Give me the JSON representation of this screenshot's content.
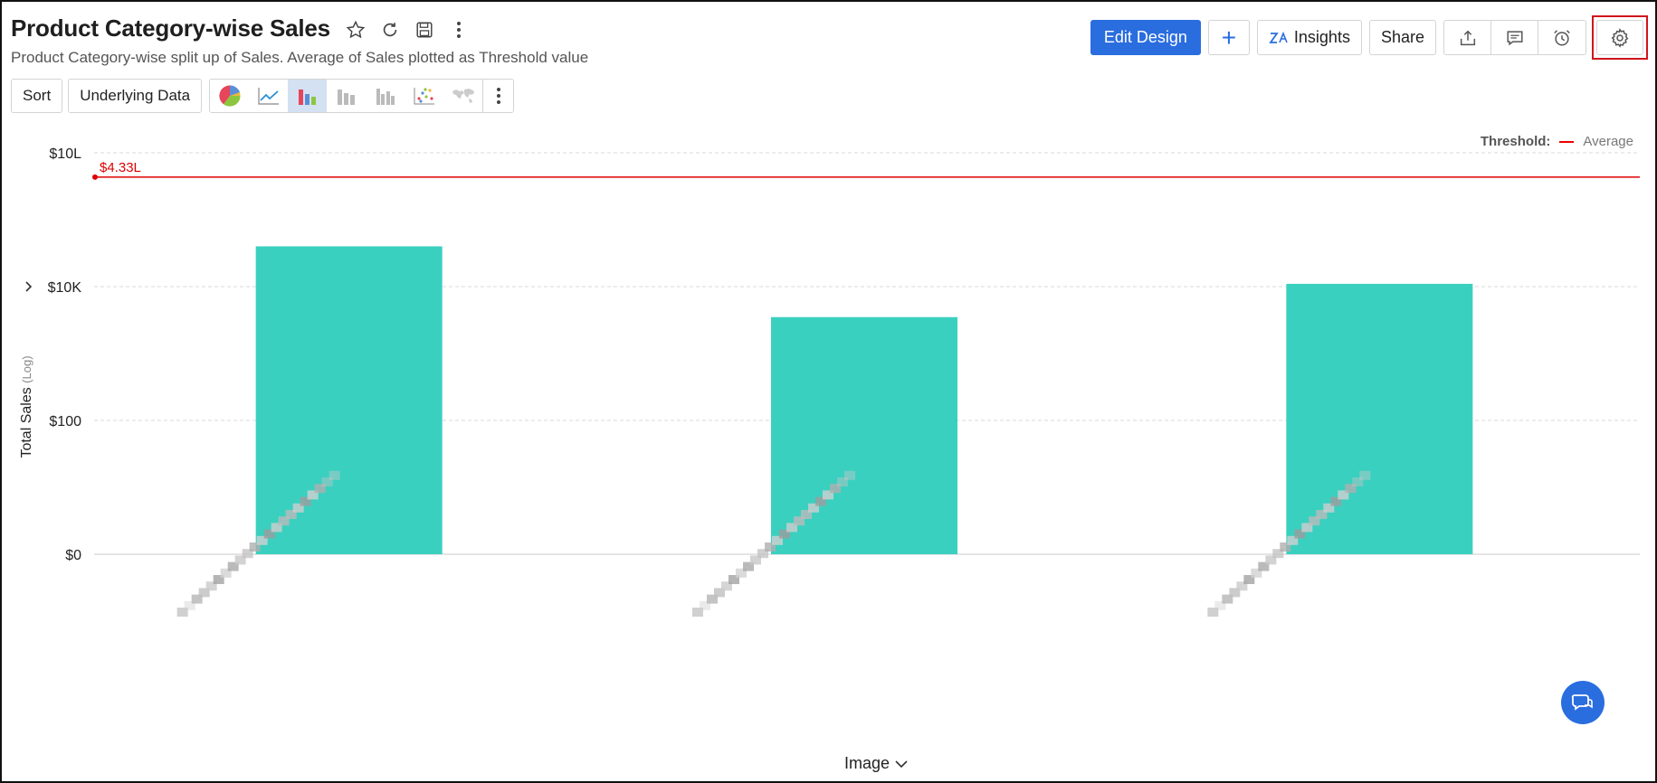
{
  "header": {
    "title": "Product Category-wise Sales",
    "subtitle": "Product Category-wise split up of Sales. Average of Sales plotted as Threshold value"
  },
  "topbar": {
    "edit_design": "Edit Design",
    "add": "+",
    "insights": "Insights",
    "share": "Share"
  },
  "toolbar": {
    "sort": "Sort",
    "underlying_data": "Underlying Data",
    "chart_types": [
      "pie-chart",
      "line-chart",
      "bar-chart",
      "stacked-bar-chart",
      "grouped-bar-chart",
      "scatter-chart",
      "map-chart"
    ],
    "active_chart_type": "bar-chart"
  },
  "legend": {
    "threshold_label": "Threshold:",
    "threshold_name": "Average"
  },
  "chart_data": {
    "type": "bar",
    "yscale": "log",
    "ylabel": "Total Sales",
    "ylabel_note": "(Log)",
    "xlabel": "Image",
    "yticks": [
      {
        "value": 1,
        "label": "$0"
      },
      {
        "value": 100,
        "label": "$100"
      },
      {
        "value": 10000,
        "label": "$10K"
      },
      {
        "value": 1000000,
        "label": "$10L"
      }
    ],
    "categories": [
      "",
      "",
      ""
    ],
    "values": [
      40000,
      3500,
      11000
    ],
    "threshold": {
      "value": 433000,
      "label": "$4.33L",
      "color": "#e00000"
    },
    "bar_color": "#3ad0c0",
    "grid": true
  },
  "colors": {
    "primary": "#2a6ddf",
    "highlight_border": "#d0141c"
  }
}
